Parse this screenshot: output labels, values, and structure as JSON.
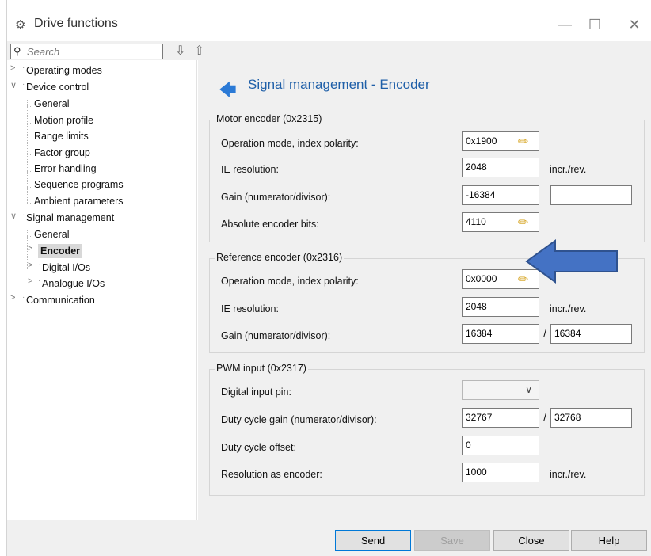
{
  "window": {
    "title": "Drive functions",
    "title_icon": "gear-network-icon",
    "minimize_glyph": "—",
    "maximize_glyph": "☐",
    "close_glyph": "✕"
  },
  "toolbar": {
    "search_placeholder": "Search",
    "search_value": "",
    "down_arrow": "⇩",
    "up_arrow": "⇧"
  },
  "nav": {
    "items": [
      {
        "label": "Operating modes",
        "level": 0,
        "expander": ">"
      },
      {
        "label": "Device control",
        "level": 0,
        "expander": "∨"
      },
      {
        "label": "General",
        "level": 1
      },
      {
        "label": "Motion profile",
        "level": 1
      },
      {
        "label": "Range limits",
        "level": 1
      },
      {
        "label": "Factor group",
        "level": 1
      },
      {
        "label": "Error handling",
        "level": 1
      },
      {
        "label": "Sequence programs",
        "level": 1
      },
      {
        "label": "Ambient parameters",
        "level": 1
      },
      {
        "label": "Signal management",
        "level": 0,
        "expander": "∨"
      },
      {
        "label": "General",
        "level": 1
      },
      {
        "label": "Encoder",
        "level": 1,
        "expander": ">",
        "selected": true
      },
      {
        "label": "Digital I/Os",
        "level": 1,
        "expander": ">"
      },
      {
        "label": "Analogue I/Os",
        "level": 1,
        "expander": ">"
      },
      {
        "label": "Communication",
        "level": 0,
        "expander": ">"
      }
    ]
  },
  "content": {
    "back_glyph": "🡄",
    "heading": "Signal management - Encoder",
    "motor": {
      "legend": "Motor encoder (0x2315)",
      "op_mode_label": "Operation mode, index polarity:",
      "op_mode_value": "0x1900",
      "ie_res_label": "IE resolution:",
      "ie_res_value": "2048",
      "ie_res_unit": "incr./rev.",
      "gain_label": "Gain  (numerator/divisor):",
      "gain_num": "-16384",
      "gain_div": "",
      "abs_bits_label": "Absolute encoder bits:",
      "abs_bits_value": "4110"
    },
    "reference": {
      "legend": "Reference encoder (0x2316)",
      "op_mode_label": "Operation mode, index polarity:",
      "op_mode_value": "0x0000",
      "ie_res_label": "IE resolution:",
      "ie_res_value": "2048",
      "ie_res_unit": "incr./rev.",
      "gain_label": "Gain  (numerator/divisor):",
      "gain_num": "16384",
      "gain_div": "16384"
    },
    "pwm": {
      "legend": "PWM input (0x2317)",
      "dig_pin_label": "Digital input pin:",
      "dig_pin_value": "-",
      "duty_gain_label": "Duty cycle  gain (numerator/divisor):",
      "duty_gain_num": "32767",
      "duty_gain_div": "32768",
      "duty_offset_label": "Duty cycle offset:",
      "duty_offset_value": "0",
      "res_label": "Resolution as encoder:",
      "res_value": "1000",
      "res_unit": "incr./rev."
    },
    "slash": "/",
    "pencil_glyph": "✏",
    "chevron_glyph": "∨"
  },
  "footer": {
    "send": "Send",
    "save": "Save",
    "close": "Close",
    "help": "Help"
  },
  "colors": {
    "accent": "#2b7ad6",
    "callout_fill": "#4472c4",
    "callout_stroke": "#2f528f"
  }
}
